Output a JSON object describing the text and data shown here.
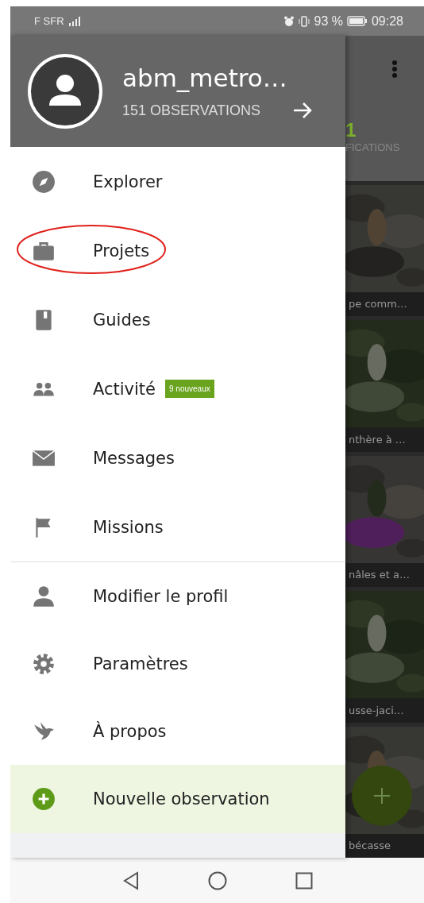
{
  "status_bar": {
    "carrier": "F SFR",
    "battery": "93 %",
    "time": "09:28"
  },
  "drawer": {
    "username": "abm_metro…",
    "observations": "151 OBSERVATIONS",
    "sections": [
      {
        "items": [
          {
            "label": "Explorer",
            "circled": false
          },
          {
            "label": "Projets",
            "circled": true
          },
          {
            "label": "Guides",
            "circled": false
          },
          {
            "label": "Activité",
            "circled": false,
            "badge": "9 nouveaux"
          },
          {
            "label": "Messages",
            "circled": false
          },
          {
            "label": "Missions",
            "circled": false
          }
        ]
      },
      {
        "items": [
          {
            "label": "Modifier le profil",
            "circled": false
          },
          {
            "label": "Paramètres",
            "circled": false
          },
          {
            "label": "À propos",
            "circled": false
          }
        ]
      }
    ],
    "new_observation": {
      "label": "Nouvelle observation"
    }
  },
  "background": {
    "count": "1",
    "tab_label": "FICATIONS",
    "tiles": [
      {
        "caption": "pe comm…"
      },
      {
        "caption": "nthère à …"
      },
      {
        "caption": "nâles et a…"
      },
      {
        "caption": "usse-jaci…"
      },
      {
        "caption": "bécasse"
      }
    ]
  }
}
